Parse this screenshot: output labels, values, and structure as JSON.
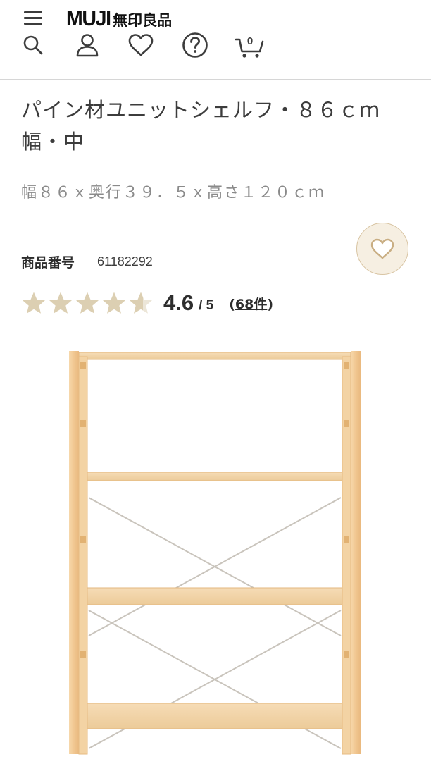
{
  "header": {
    "logo_latin": "MUJI",
    "logo_jp": "無印良品",
    "cart_count": "0",
    "icons": [
      "menu-icon",
      "search-icon",
      "user-icon",
      "heart-icon",
      "help-icon",
      "cart-icon"
    ]
  },
  "product": {
    "title": "パイン材ユニットシェルフ・８６ｃｍ幅・中",
    "spec": "幅８６ｘ奥行３９．５ｘ高さ１２０ｃｍ",
    "code_label": "商品番号",
    "code_value": "61182292",
    "rating": {
      "stars_filled": 4.6,
      "score": "4.6",
      "scale": "/ 5",
      "reviews_open": "(",
      "reviews_count": "68件",
      "reviews_close": ")"
    }
  },
  "colors": {
    "text": "#3c3c3c",
    "muted": "#8a8a8a",
    "star": "#dccfb2",
    "fav_bg": "#f6efe2",
    "fav_border": "#d8c4a2",
    "wood": "#f2cd9c"
  }
}
